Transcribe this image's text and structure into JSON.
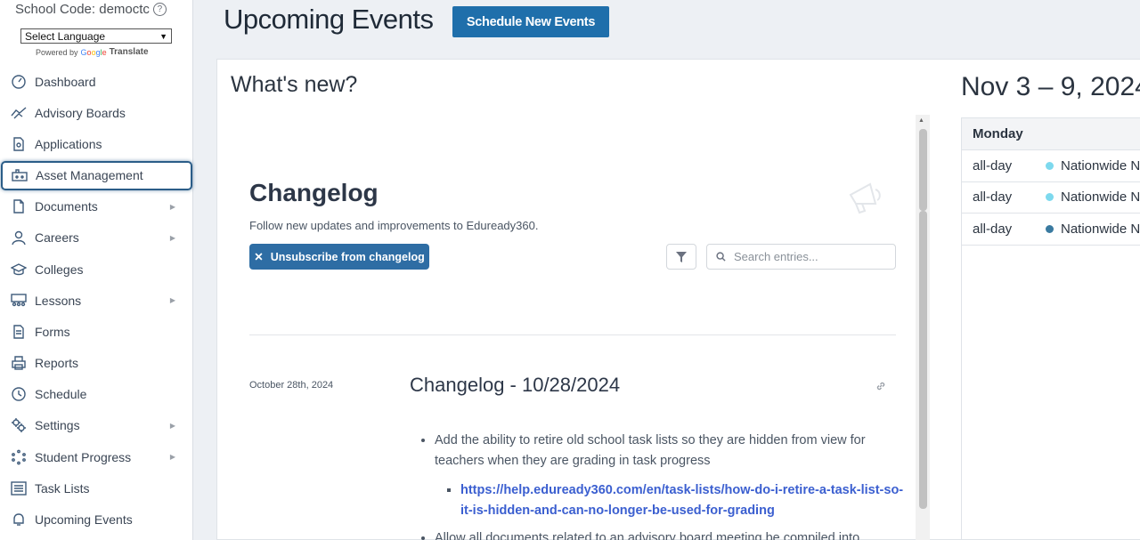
{
  "sidebar": {
    "school_code": "School Code: democtc",
    "language_select": "Select Language",
    "powered_by": "Powered by",
    "google": "Google",
    "translate": "Translate",
    "items": [
      {
        "label": "Dashboard",
        "icon": "dashboard-icon",
        "has_children": false
      },
      {
        "label": "Advisory Boards",
        "icon": "handshake-icon",
        "has_children": false
      },
      {
        "label": "Applications",
        "icon": "application-document-icon",
        "has_children": false
      },
      {
        "label": "Asset Management",
        "icon": "asset-icon",
        "has_children": false,
        "active": true
      },
      {
        "label": "Documents",
        "icon": "document-icon",
        "has_children": true
      },
      {
        "label": "Careers",
        "icon": "person-icon",
        "has_children": true
      },
      {
        "label": "Colleges",
        "icon": "graduation-cap-icon",
        "has_children": false
      },
      {
        "label": "Lessons",
        "icon": "classroom-icon",
        "has_children": true
      },
      {
        "label": "Forms",
        "icon": "form-icon",
        "has_children": false
      },
      {
        "label": "Reports",
        "icon": "printer-icon",
        "has_children": false
      },
      {
        "label": "Schedule",
        "icon": "clock-icon",
        "has_children": false
      },
      {
        "label": "Settings",
        "icon": "gears-icon",
        "has_children": true
      },
      {
        "label": "Student Progress",
        "icon": "progress-icon",
        "has_children": true
      },
      {
        "label": "Task Lists",
        "icon": "list-icon",
        "has_children": false
      },
      {
        "label": "Upcoming Events",
        "icon": "bell-icon",
        "has_children": false
      }
    ]
  },
  "header": {
    "title": "Upcoming Events",
    "schedule_button": "Schedule New Events"
  },
  "main": {
    "whats_new": "What's new?",
    "changelog": {
      "title": "Changelog",
      "subtitle": "Follow new updates and improvements to Eduready360.",
      "unsubscribe_button": "Unsubscribe from changelog",
      "search_placeholder": "Search entries...",
      "entry": {
        "date": "October 28th, 2024",
        "title": "Changelog - 10/28/2024",
        "bullet1": "Add the ability to retire old school task lists so they are hidden from view for teachers when they are grading in task progress",
        "bullet1_link": "https://help.eduready360.com/en/task-lists/how-do-i-retire-a-task-list-so-it-is-hidden-and-can-no-longer-be-used-for-grading",
        "bullet2": "Allow all documents related to an advisory board meeting be compiled into"
      }
    },
    "calendar": {
      "title": "Nov 3 – 9, 2024",
      "day_header": "Monday",
      "events": [
        {
          "time": "all-day",
          "name": "Nationwide N",
          "color": "#7dd9ee"
        },
        {
          "time": "all-day",
          "name": "Nationwide N",
          "color": "#7dd9ee"
        },
        {
          "time": "all-day",
          "name": "Nationwide N",
          "color": "#3a7aa0"
        }
      ]
    }
  },
  "colors": {
    "accent": "#1f6fab",
    "active_border": "#2b5d88"
  }
}
